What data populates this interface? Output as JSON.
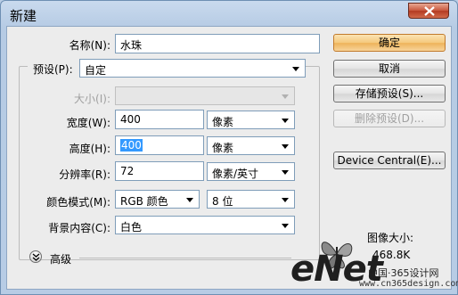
{
  "window": {
    "title": "新建"
  },
  "form": {
    "name_label": "名称(N):",
    "name_value": "水珠",
    "preset_label": "预设(P):",
    "preset_value": "自定",
    "size_label": "大小(I):",
    "size_value": "",
    "width_label": "宽度(W):",
    "width_value": "400",
    "width_unit": "像素",
    "height_label": "高度(H):",
    "height_value": "400",
    "height_unit": "像素",
    "resolution_label": "分辨率(R):",
    "resolution_value": "72",
    "resolution_unit": "像素/英寸",
    "color_mode_label": "颜色模式(M):",
    "color_mode_value": "RGB 颜色",
    "bit_depth_value": "8 位",
    "background_label": "背景内容(C):",
    "background_value": "白色",
    "advanced_label": "高级"
  },
  "buttons": {
    "ok": "确定",
    "cancel": "取消",
    "save_preset": "存储预设(S)...",
    "delete_preset": "删除预设(D)...",
    "device_central": "Device Central(E)..."
  },
  "image_size": {
    "label": "图像大小:",
    "value": "468.8K"
  },
  "watermark": {
    "brand": "eNet",
    "cn_text": "中国·365设计网",
    "url": "www.cn365design.com"
  },
  "icons": {
    "close": "close-icon",
    "advanced_toggle": "chevron-double-down-icon",
    "butterfly": "butterfly-logo"
  },
  "colors": {
    "title_bar": "#b9cde5",
    "primary_button": "#f5c97d",
    "close_button": "#c8563c",
    "selection": "#3399ff"
  }
}
